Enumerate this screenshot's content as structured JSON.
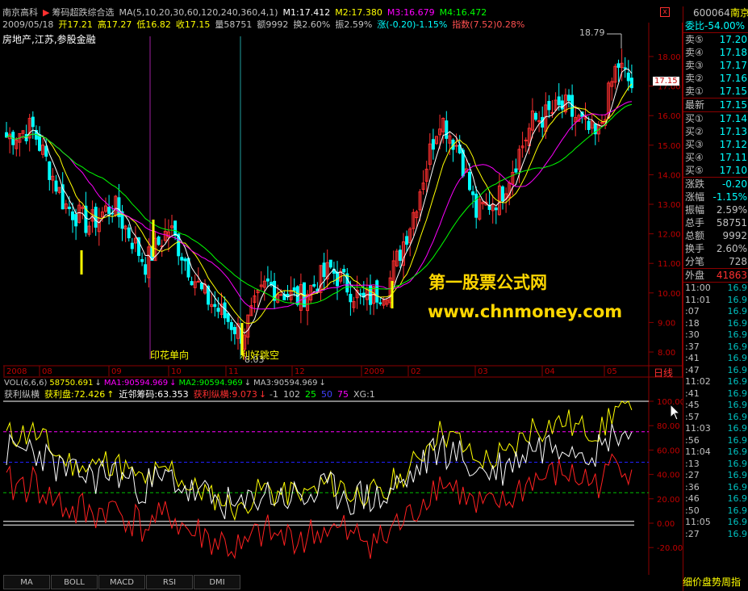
{
  "header": {
    "stock_name": "南京高科",
    "indicator_name": "筹码超跌综合选",
    "ma_params": "MA(5,10,20,30,60,120,240,360,4,1)",
    "m1": "M1:17.412",
    "m2": "M2:17.380",
    "m3": "M3:16.679",
    "m4": "M4:16.472",
    "date": "2009/05/18",
    "open": "开17.21",
    "high": "高17.27",
    "low": "低16.82",
    "close": "收17.15",
    "volume": "量58751",
    "amount": "额9992",
    "turnover": "换2.60%",
    "amplitude": "振2.59%",
    "change": "涨(-0.20)-1.15%",
    "index": "指数(7.52)0.28%",
    "sectors": "房地产,江苏,参股金融",
    "close_icon": "close-icon"
  },
  "main_chart": {
    "max_label": "18.79",
    "min_label": "8.03",
    "current_price_label": "17.15",
    "annotation_1": "印花单向",
    "annotation_2": "利好跳空",
    "price_axis": [
      "18.00",
      "17.00",
      "16.00",
      "15.00",
      "14.00",
      "13.00",
      "12.00",
      "11.00",
      "10.00",
      "9.00",
      "8.00"
    ],
    "date_labels": [
      "2008",
      "08",
      "09",
      "10",
      "11",
      "12",
      "2009",
      "02",
      "03",
      "04",
      "05"
    ],
    "axis_mode": "日线"
  },
  "volume_bar": {
    "vol_params": "VOL(6,6,6)",
    "vol": "58750.691",
    "ma1": "MA1:90594.969",
    "ma2": "MA2:90594.969",
    "ma3": "MA3:90594.969"
  },
  "indicator": {
    "name": "获利纵横",
    "profit": "获利盘:72.426",
    "near": "近邻筹码:63.353",
    "zongheng": "获利纵横:9.073",
    "p1": "-1",
    "p2": "102",
    "p3": "25",
    "p4": "50",
    "p5": "75",
    "xg": "XG:1",
    "axis": [
      "100.00",
      "80.00",
      "60.00",
      "40.00",
      "20.00",
      "0.00",
      "-20.00"
    ]
  },
  "watermark": {
    "line1": "第一股票公式网",
    "line2": "www.chnmoney.com"
  },
  "quote_panel": {
    "code": "600064",
    "name": "南京",
    "weibi": "委比-54.00%",
    "asks": [
      {
        "label": "卖⑤",
        "price": "17.20"
      },
      {
        "label": "卖④",
        "price": "17.18"
      },
      {
        "label": "卖③",
        "price": "17.17"
      },
      {
        "label": "卖②",
        "price": "17.16"
      },
      {
        "label": "卖①",
        "price": "17.15"
      }
    ],
    "last": {
      "label": "最新",
      "price": "17.15"
    },
    "bids": [
      {
        "label": "买①",
        "price": "17.14"
      },
      {
        "label": "买②",
        "price": "17.13"
      },
      {
        "label": "买③",
        "price": "17.12"
      },
      {
        "label": "买④",
        "price": "17.11"
      },
      {
        "label": "买⑤",
        "price": "17.10"
      }
    ],
    "stats": [
      {
        "label": "涨跌",
        "value": "-0.20"
      },
      {
        "label": "涨幅",
        "value": "-1.15%"
      },
      {
        "label": "振幅",
        "value": "2.59%"
      },
      {
        "label": "总手",
        "value": "58751"
      },
      {
        "label": "总额",
        "value": "9992"
      },
      {
        "label": "换手",
        "value": "2.60%"
      },
      {
        "label": "分笔",
        "value": "728"
      }
    ],
    "outer": {
      "label": "外盘",
      "value": "41863"
    },
    "ticks": [
      {
        "t": "11:00",
        "p": "16.9"
      },
      {
        "t": "11:01",
        "p": "16.9"
      },
      {
        "t": ":07",
        "p": "16.9"
      },
      {
        "t": ":18",
        "p": "16.9"
      },
      {
        "t": ":30",
        "p": "16.9"
      },
      {
        "t": ":37",
        "p": "16.9"
      },
      {
        "t": ":41",
        "p": "16.9"
      },
      {
        "t": ":47",
        "p": "16.9"
      },
      {
        "t": "11:02",
        "p": "16.9"
      },
      {
        "t": ":41",
        "p": "16.9"
      },
      {
        "t": ":45",
        "p": "16.9"
      },
      {
        "t": ":57",
        "p": "16.9"
      },
      {
        "t": "11:03",
        "p": "16.9"
      },
      {
        "t": ":56",
        "p": "16.9"
      },
      {
        "t": "11:04",
        "p": "16.9"
      },
      {
        "t": ":13",
        "p": "16.9"
      },
      {
        "t": ":27",
        "p": "16.9"
      },
      {
        "t": ":36",
        "p": "16.9"
      },
      {
        "t": ":46",
        "p": "16.9"
      },
      {
        "t": ":50",
        "p": "16.9"
      },
      {
        "t": "11:05",
        "p": "16.9"
      },
      {
        "t": ":27",
        "p": "16.9"
      }
    ],
    "bottom_tab": "细价盘势周指"
  },
  "tabs": [
    "MA",
    "BOLL",
    "MACD",
    "RSI",
    "DMI"
  ]
}
